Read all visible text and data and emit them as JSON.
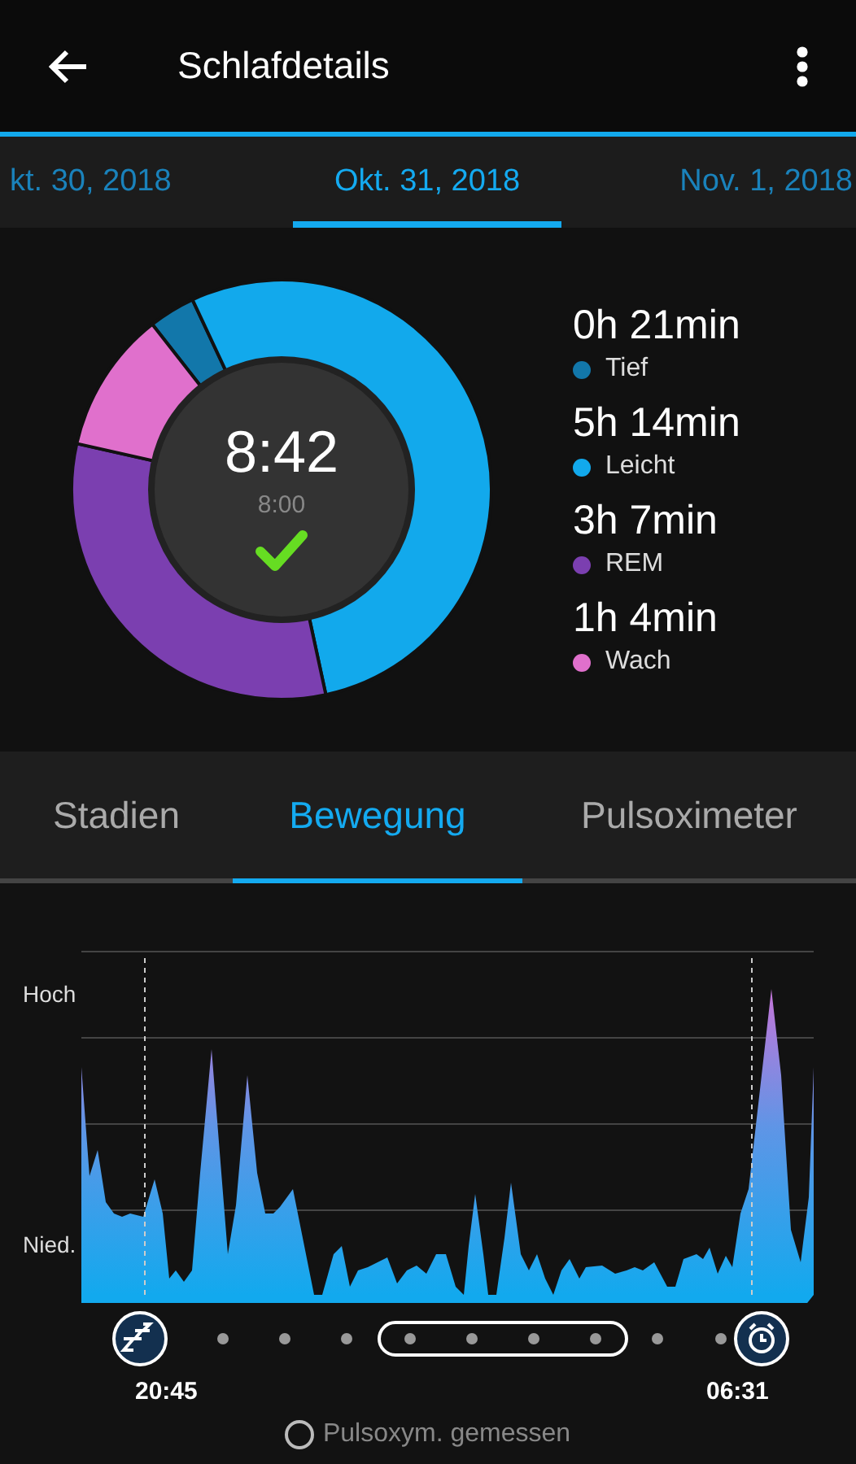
{
  "header": {
    "title": "Schlafdetails"
  },
  "date_tabs": [
    {
      "label": "kt. 30, 2018",
      "selected": false
    },
    {
      "label": "Okt. 31, 2018",
      "selected": true
    },
    {
      "label": "Nov. 1, 2018",
      "selected": false
    }
  ],
  "summary": {
    "total": "8:42",
    "goal": "8:00",
    "goal_met": true,
    "chart_data": {
      "type": "donut",
      "categories": [
        "Tief",
        "Leicht",
        "REM",
        "Wach"
      ],
      "values": [
        3.58,
        53.59,
        31.91,
        10.92
      ]
    },
    "legend": [
      {
        "duration": "0h 21min",
        "color": "#1277aa"
      },
      {
        "duration": "5h 14min",
        "color": "#12a9ec"
      },
      {
        "duration": "3h 7min",
        "color": "#7b3fb0"
      },
      {
        "duration": "1h 4min",
        "color": "#e070cc"
      }
    ]
  },
  "view_tabs": [
    {
      "label": "Stadien",
      "selected": false
    },
    {
      "label": "Bewegung",
      "selected": true
    },
    {
      "label": "Pulsoximeter",
      "selected": false
    }
  ],
  "movement": {
    "y_labels": [
      "Hoch",
      "Nied."
    ],
    "start_time": "20:45",
    "end_time": "06:31",
    "legend": "Pulsoxym. gemessen"
  }
}
